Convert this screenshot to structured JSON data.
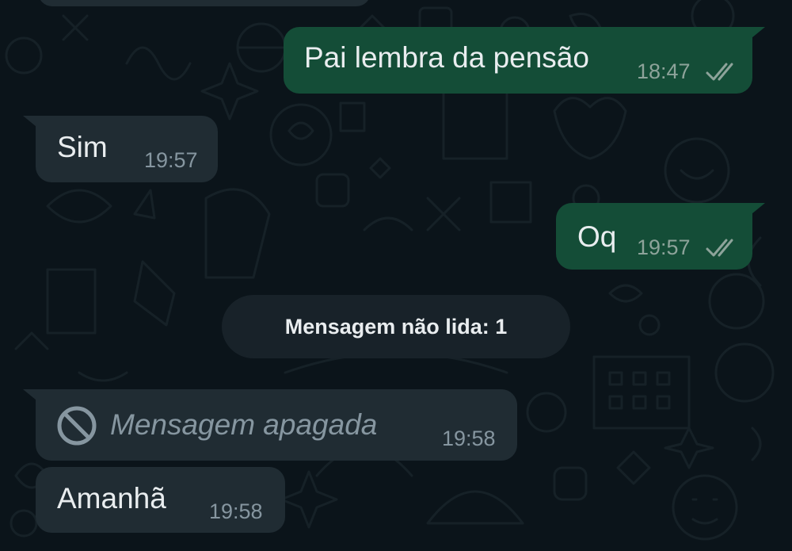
{
  "colors": {
    "background": "#0b141a",
    "outgoing_bubble": "#144d37",
    "incoming_bubble": "#202c33",
    "read_ticks": "#8da39a"
  },
  "messages": [
    {
      "direction": "outgoing",
      "text": "Pai lembra da pensão",
      "time": "18:47",
      "status_icon": "double-check-icon"
    },
    {
      "direction": "incoming",
      "text": "Sim",
      "time": "19:57"
    },
    {
      "direction": "outgoing",
      "text": "Oq",
      "time": "19:57",
      "status_icon": "double-check-icon"
    },
    {
      "direction": "incoming",
      "deleted": true,
      "text": "Mensagem apagada",
      "time": "19:58",
      "icon": "blocked-icon"
    },
    {
      "direction": "incoming",
      "text": "Amanhã",
      "time": "19:58"
    }
  ],
  "unread_divider": {
    "label": "Mensagem não lida: 1"
  }
}
